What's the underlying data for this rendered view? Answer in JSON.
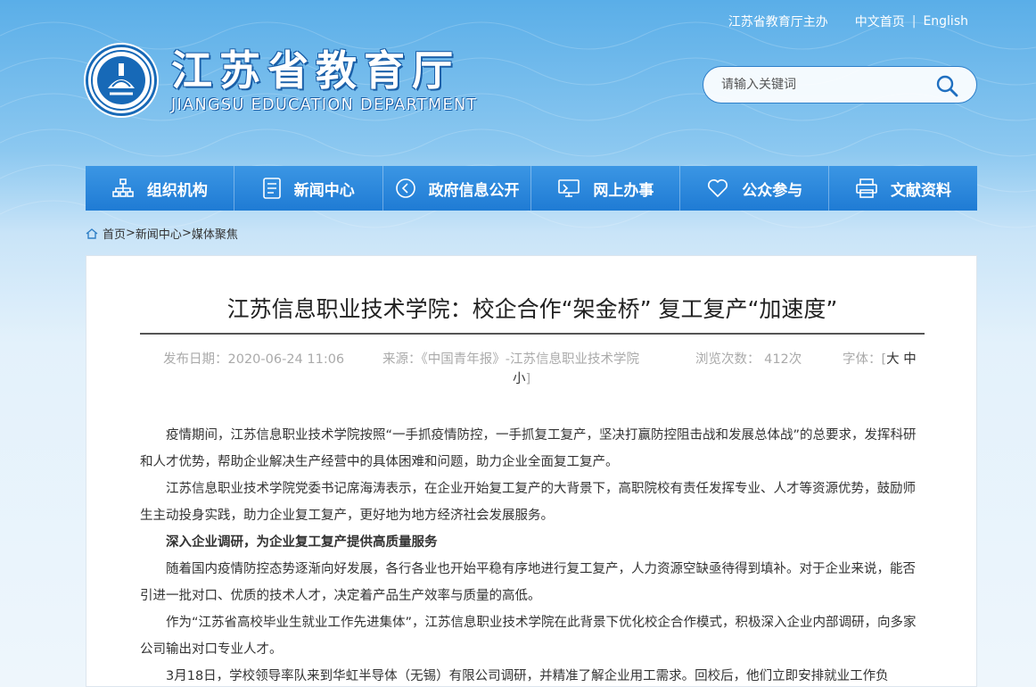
{
  "header": {
    "host_text": "江苏省教育厅主办",
    "lang_cn": "中文首页",
    "lang_en": "English",
    "separator": "|",
    "logo_cn": "江苏省教育厅",
    "logo_en": "JIANGSU EDUCATION DEPARTMENT",
    "search_placeholder": "请输入关键词"
  },
  "nav": {
    "items": [
      {
        "label": "组织机构",
        "icon": "org-chart-icon"
      },
      {
        "label": "新闻中心",
        "icon": "news-doc-icon"
      },
      {
        "label": "政府信息公开",
        "icon": "info-arrow-icon"
      },
      {
        "label": "网上办事",
        "icon": "monitor-icon"
      },
      {
        "label": "公众参与",
        "icon": "heart-icon"
      },
      {
        "label": "文献资料",
        "icon": "printer-icon"
      }
    ]
  },
  "breadcrumb": {
    "home": "首页",
    "sep1": ">",
    "level1": "新闻中心",
    "sep2": ">",
    "level2": "媒体聚焦"
  },
  "article": {
    "title": "江苏信息职业技术学院：校企合作“架金桥” 复工复产“加速度”",
    "date": "发布日期：2020-06-24 11:06",
    "source": "来源：《中国青年报》-江苏信息职业技术学院",
    "views": "浏览次数：  412次",
    "font_label": "字体：[",
    "font_large": "大",
    "font_medium": "中",
    "font_small": "小",
    "font_close": "]",
    "paragraphs": [
      {
        "text": "疫情期间，江苏信息职业技术学院按照“一手抓疫情防控，一手抓复工复产，坚决打赢防控阻击战和发展总体战”的总要求，发挥科研和人才优势，帮助企业解决生产经营中的具体困难和问题，助力企业全面复工复产。",
        "bold": false
      },
      {
        "text": "江苏信息职业技术学院党委书记席海涛表示，在企业开始复工复产的大背景下，高职院校有责任发挥专业、人才等资源优势，鼓励师生主动投身实践，助力企业复工复产，更好地为地方经济社会发展服务。",
        "bold": false
      },
      {
        "text": "深入企业调研，为企业复工复产提供高质量服务",
        "bold": true
      },
      {
        "text": "随着国内疫情防控态势逐渐向好发展，各行各业也开始平稳有序地进行复工复产，人力资源空缺亟待得到填补。对于企业来说，能否引进一批对口、优质的技术人才，决定着产品生产效率与质量的高低。",
        "bold": false
      },
      {
        "text": "作为“江苏省高校毕业生就业工作先进集体”，江苏信息职业技术学院在此背景下优化校企合作模式，积极深入企业内部调研，向多家公司输出对口专业人才。",
        "bold": false
      },
      {
        "text": "3月18日，学校领导率队来到华虹半导体（无锡）有限公司调研，并精准了解企业用工需求。回校后，他们立即安排就业工作负",
        "bold": false
      }
    ]
  }
}
